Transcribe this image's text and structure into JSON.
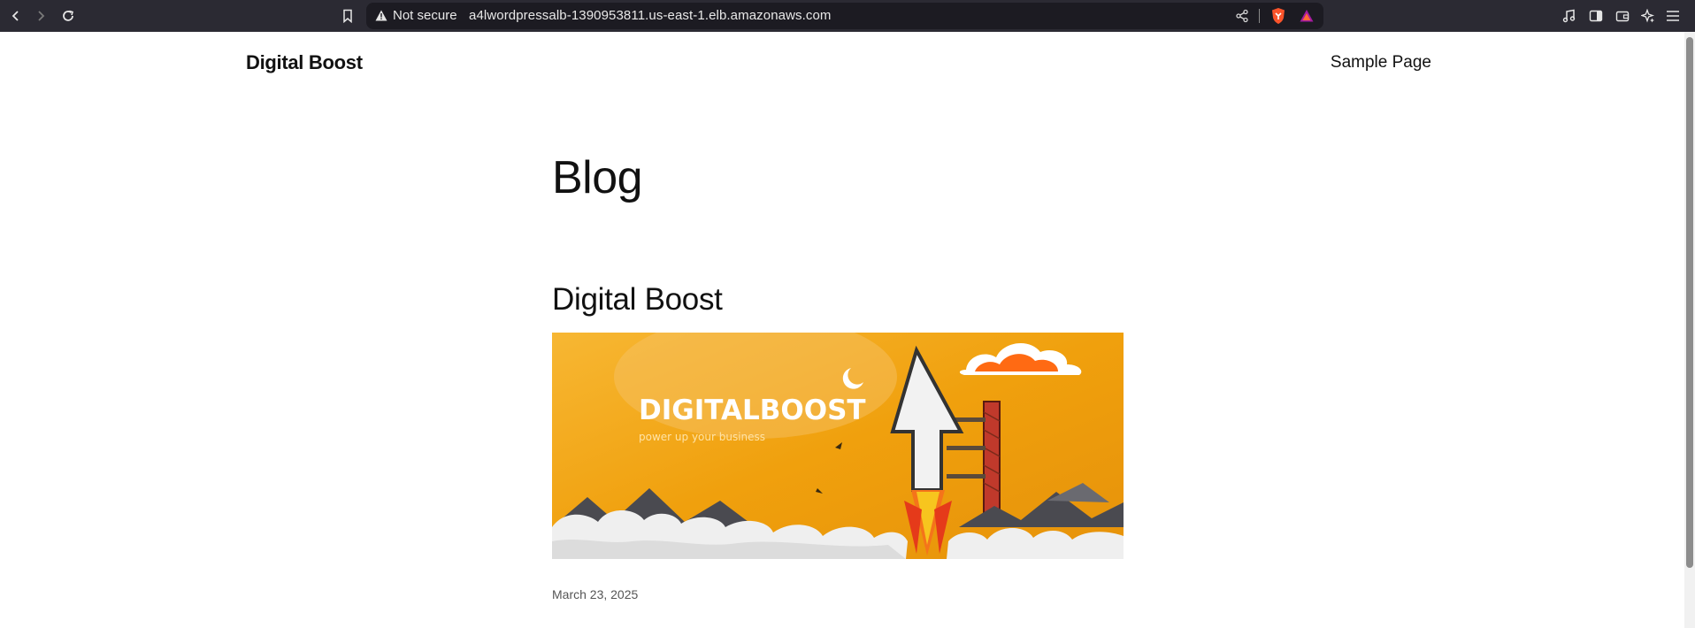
{
  "browser": {
    "not_secure_label": "Not secure",
    "url": "a4lwordpressalb-1390953811.us-east-1.elb.amazonaws.com",
    "icons": [
      "back-icon",
      "forward-icon",
      "reload-icon",
      "bookmark-icon",
      "warning-icon",
      "share-icon",
      "brave-shield-icon",
      "brave-rewards-icon",
      "media-icon",
      "sidebar-icon",
      "wallet-icon",
      "leo-ai-icon",
      "menu-icon"
    ]
  },
  "site": {
    "title": "Digital Boost",
    "nav": {
      "sample_page": "Sample Page"
    }
  },
  "main": {
    "heading": "Blog",
    "post": {
      "title": "Digital Boost",
      "image": {
        "brand_text": "DIGITALBOOST",
        "tagline": "power up your business"
      },
      "date": "March 23, 2025"
    }
  },
  "colors": {
    "chrome_bg": "#2b2a33",
    "urlbar_bg": "#1c1b22",
    "banner_orange": "#f2a20c",
    "page_bg": "#ffffff"
  }
}
